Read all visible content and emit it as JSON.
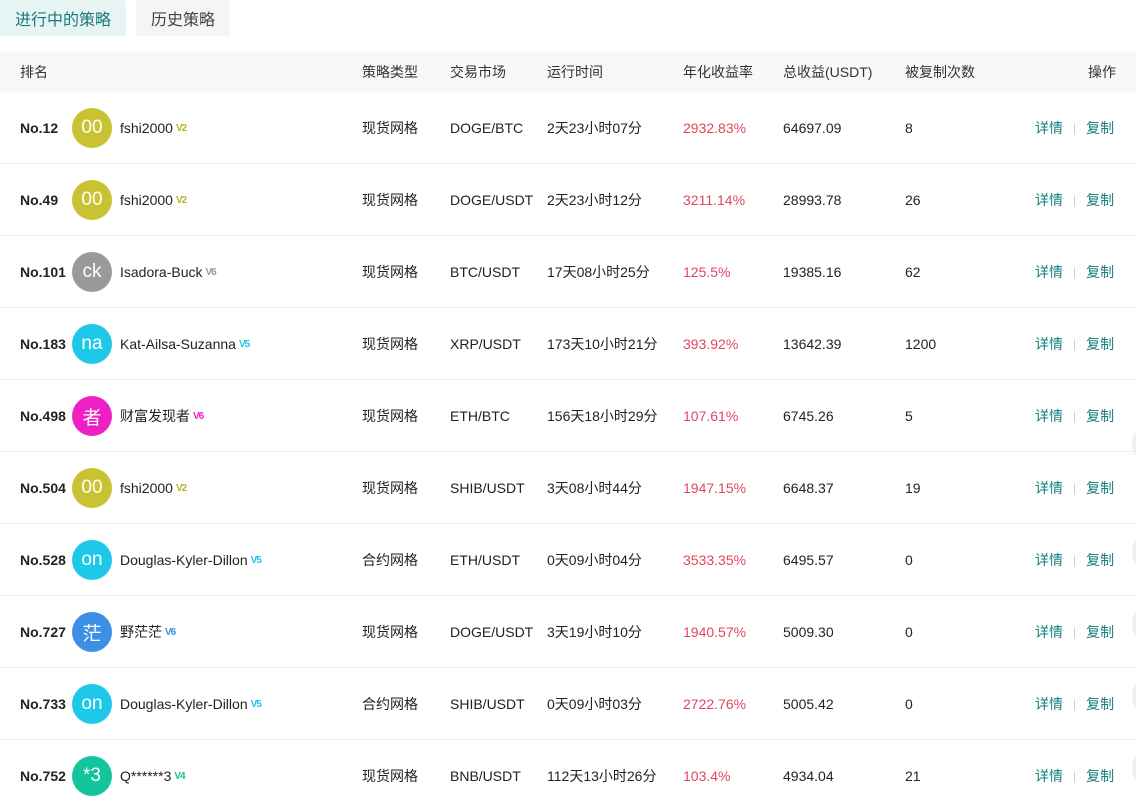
{
  "tabs": [
    {
      "label": "进行中的策略",
      "active": true
    },
    {
      "label": "历史策略",
      "active": false
    }
  ],
  "headers": {
    "rank": "排名",
    "type": "策略类型",
    "market": "交易市场",
    "time": "运行时间",
    "apy": "年化收益率",
    "total": "总收益(USDT)",
    "copies": "被复制次数",
    "ops": "操作"
  },
  "ops_labels": {
    "detail": "详情",
    "copy": "复制"
  },
  "colors": {
    "accent": "#13807e",
    "profit": "#e0465e"
  },
  "rows": [
    {
      "rank": "No.12",
      "avatar": "00",
      "avatar_color": "#c9c233",
      "user": "fshi2000",
      "vip": "V2",
      "vip_color": "#b9b329",
      "type": "现货网格",
      "market": "DOGE/BTC",
      "time": "2天23小时07分",
      "apy": "2932.83%",
      "total": "64697.09",
      "copies": "8"
    },
    {
      "rank": "No.49",
      "avatar": "00",
      "avatar_color": "#c9c233",
      "user": "fshi2000",
      "vip": "V2",
      "vip_color": "#b9b329",
      "type": "现货网格",
      "market": "DOGE/USDT",
      "time": "2天23小时12分",
      "apy": "3211.14%",
      "total": "28993.78",
      "copies": "26"
    },
    {
      "rank": "No.101",
      "avatar": "ck",
      "avatar_color": "#9a9a9a",
      "user": "Isadora-Buck",
      "vip": "V6",
      "vip_color": "#9a9a9a",
      "type": "现货网格",
      "market": "BTC/USDT",
      "time": "17天08小时25分",
      "apy": "125.5%",
      "total": "19385.16",
      "copies": "62"
    },
    {
      "rank": "No.183",
      "avatar": "na",
      "avatar_color": "#1ec8e8",
      "user": "Kat-Ailsa-Suzanna",
      "vip": "V5",
      "vip_color": "#1ec8e8",
      "type": "现货网格",
      "market": "XRP/USDT",
      "time": "173天10小时21分",
      "apy": "393.92%",
      "total": "13642.39",
      "copies": "1200"
    },
    {
      "rank": "No.498",
      "avatar": "者",
      "avatar_color": "#ee1fc4",
      "user": "财富发现者",
      "vip": "V6",
      "vip_color": "#ee1fc4",
      "type": "现货网格",
      "market": "ETH/BTC",
      "time": "156天18小时29分",
      "apy": "107.61%",
      "total": "6745.26",
      "copies": "5"
    },
    {
      "rank": "No.504",
      "avatar": "00",
      "avatar_color": "#c9c233",
      "user": "fshi2000",
      "vip": "V2",
      "vip_color": "#b9b329",
      "type": "现货网格",
      "market": "SHIB/USDT",
      "time": "3天08小时44分",
      "apy": "1947.15%",
      "total": "6648.37",
      "copies": "19"
    },
    {
      "rank": "No.528",
      "avatar": "on",
      "avatar_color": "#1ec8e8",
      "user": "Douglas-Kyler-Dillon",
      "vip": "V5",
      "vip_color": "#1ec8e8",
      "type": "合约网格",
      "market": "ETH/USDT",
      "time": "0天09小时04分",
      "apy": "3533.35%",
      "total": "6495.57",
      "copies": "0"
    },
    {
      "rank": "No.727",
      "avatar": "茫",
      "avatar_color": "#3d8fe6",
      "user": "野茫茫",
      "vip": "V6",
      "vip_color": "#3d8fe6",
      "type": "现货网格",
      "market": "DOGE/USDT",
      "time": "3天19小时10分",
      "apy": "1940.57%",
      "total": "5009.30",
      "copies": "0"
    },
    {
      "rank": "No.733",
      "avatar": "on",
      "avatar_color": "#1ec8e8",
      "user": "Douglas-Kyler-Dillon",
      "vip": "V5",
      "vip_color": "#1ec8e8",
      "type": "合约网格",
      "market": "SHIB/USDT",
      "time": "0天09小时03分",
      "apy": "2722.76%",
      "total": "5005.42",
      "copies": "0"
    },
    {
      "rank": "No.752",
      "avatar": "*3",
      "avatar_color": "#13c49c",
      "user": "Q******3",
      "vip": "V4",
      "vip_color": "#13c49c",
      "type": "现货网格",
      "market": "BNB/USDT",
      "time": "112天13小时26分",
      "apy": "103.4%",
      "total": "4934.04",
      "copies": "21"
    }
  ]
}
